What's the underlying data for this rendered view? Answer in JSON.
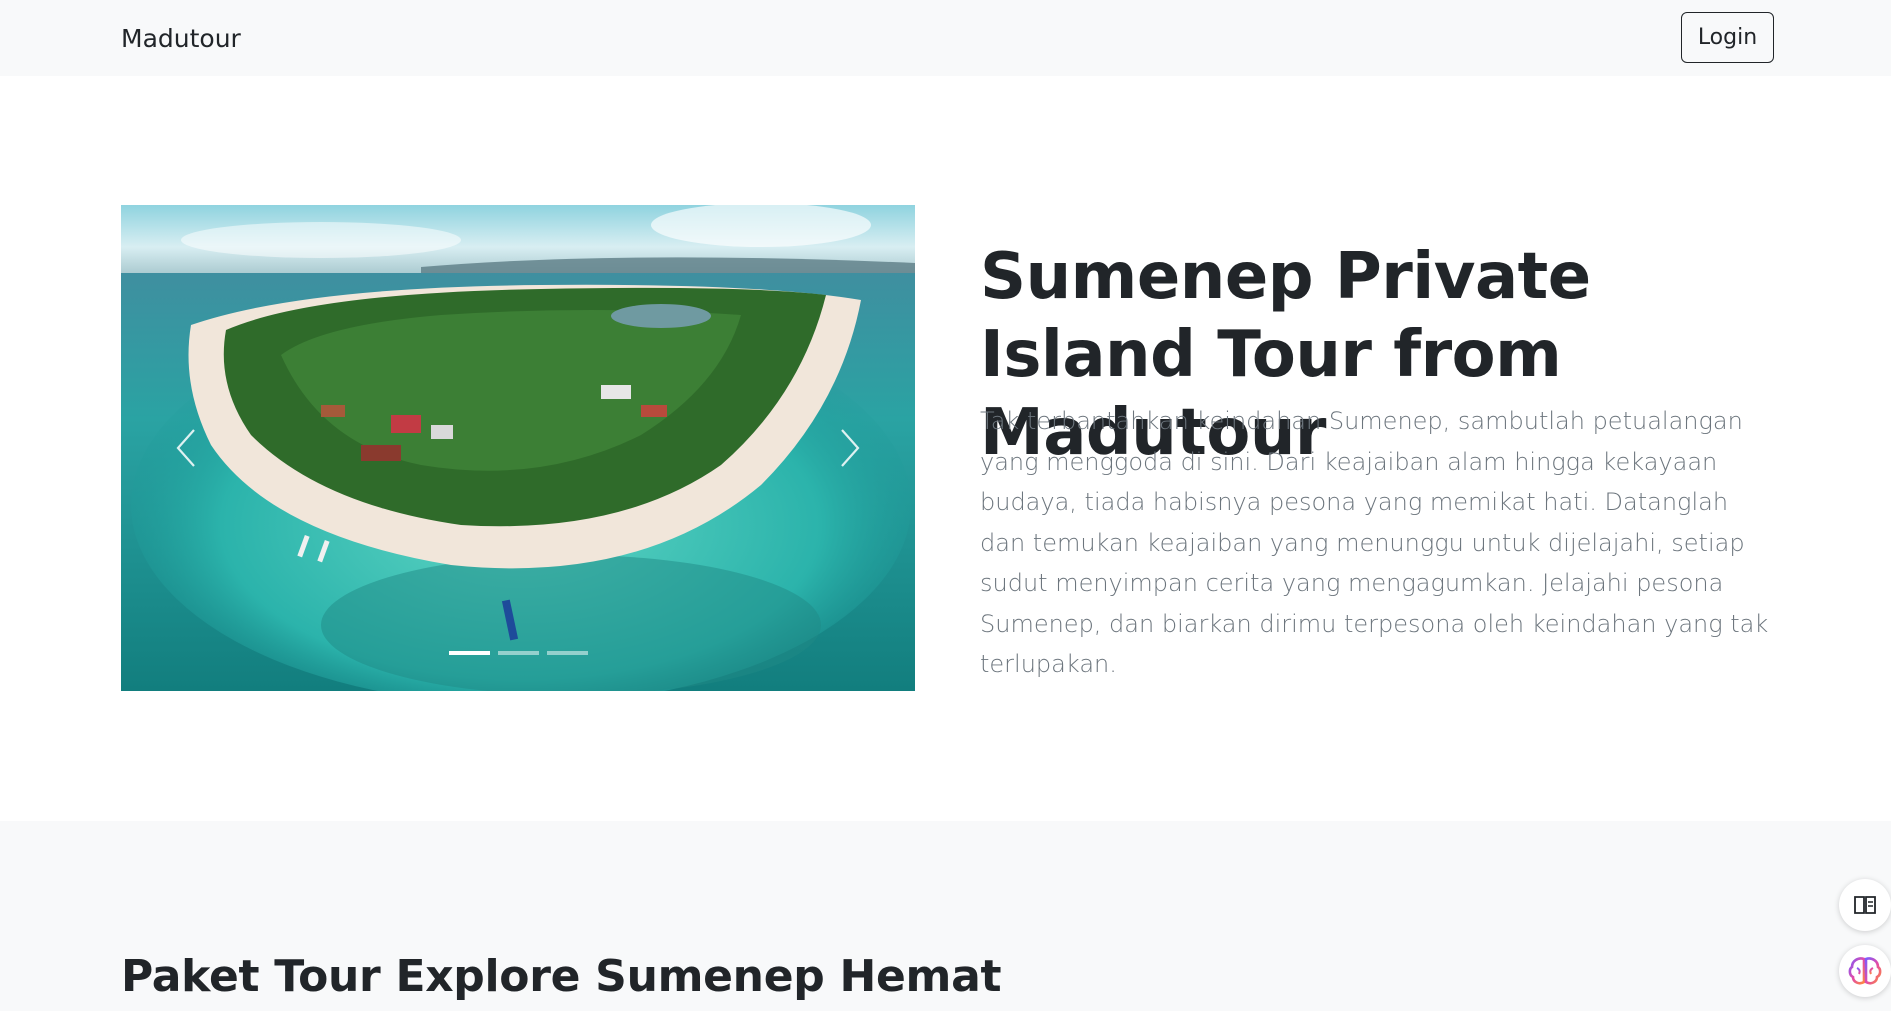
{
  "navbar": {
    "brand": "Madutour",
    "login_label": "Login"
  },
  "hero": {
    "title": "Sumenep Private Island Tour from Madutour",
    "description": "Tak terbantahkan keindahan Sumenep, sambutlah petualangan yang menggoda di sini. Dari keajaiban alam hingga kekayaan budaya, tiada habisnya pesona yang memikat hati. Datanglah dan temukan keajaiban yang menunggu untuk dijelajahi, setiap sudut menyimpan cerita yang mengagumkan. Jelajahi pesona Sumenep, dan biarkan dirimu terpesona oleh keindahan yang tak terlupakan.",
    "carousel": {
      "slide_count": 3,
      "active_index": 0,
      "prev_icon": "chevron-left-icon",
      "next_icon": "chevron-right-icon"
    }
  },
  "packages": {
    "title": "Paket Tour Explore Sumenep Hemat"
  },
  "floating": {
    "reader_icon": "book-reader-icon",
    "ai_icon": "brain-icon"
  },
  "colors": {
    "navbar_bg": "#f8f9fa",
    "text_dark": "#212529",
    "text_muted": "#6c757d",
    "section_bg": "#f8f9fa"
  }
}
